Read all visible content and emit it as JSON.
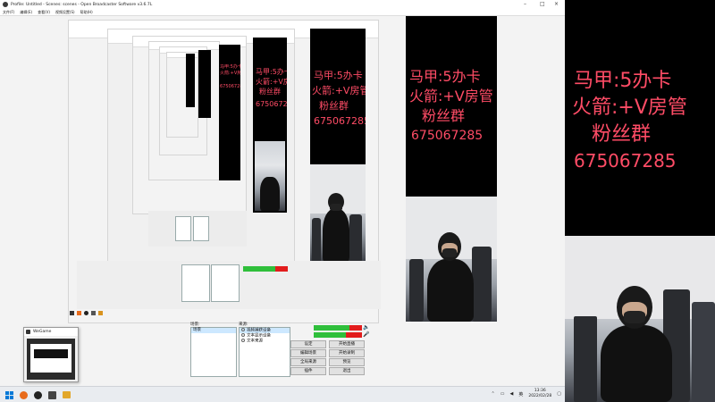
{
  "window": {
    "title": "Profile: Untitled - Scenes: scenes - Open Broadcaster Software v3.6.7L"
  },
  "menu": [
    "文件(F)",
    "编辑(E)",
    "查看(V)",
    "视频设置(S)",
    "帮助(H)"
  ],
  "overlay": {
    "line1": "马甲:5办卡",
    "line2": "火箭:+V房管",
    "line3": "粉丝群",
    "line4": "675067285"
  },
  "dock": {
    "scenes_title": "场景:",
    "sources_title": "来源:",
    "scenes": [
      "场景"
    ],
    "sources": [
      "视频捕获设备",
      "文本显示设备",
      "文本来源"
    ],
    "buttons": {
      "settings": "设定",
      "start_stream": "开始直播",
      "edit_scene": "编辑场景",
      "start_record": "开始录制",
      "global_sources": "全局来源",
      "preview": "预览",
      "exit": "退出",
      "plugins": "插件"
    }
  },
  "webcam_window": {
    "title": "WeGame"
  },
  "taskbar": {
    "lang": "英",
    "time": "13:36",
    "date": "2022/02/28"
  },
  "icons": {
    "start": "windows-start-icon",
    "search": "search-icon",
    "obs": "obs-icon",
    "browser": "browser-icon",
    "files": "folder-icon"
  },
  "colors": {
    "overlay_text": "#ff4c66",
    "panel_bg": "#000000",
    "meter_green": "#2fbf3b",
    "meter_red": "#e21c1c"
  }
}
